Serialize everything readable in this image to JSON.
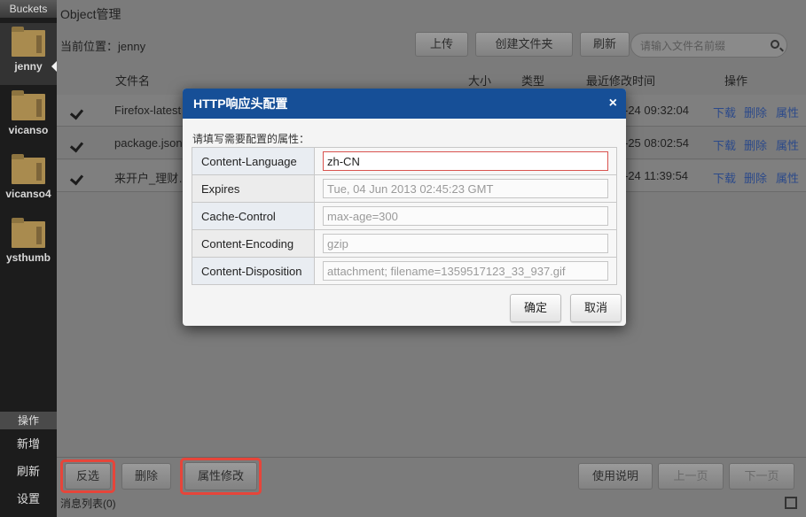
{
  "sidebar": {
    "header": "Buckets",
    "buckets": [
      {
        "label": "jenny"
      },
      {
        "label": "vicanso"
      },
      {
        "label": "vicanso4"
      },
      {
        "label": "ysthumb"
      }
    ],
    "ops_header": "操作",
    "ops": [
      {
        "label": "新增"
      },
      {
        "label": "刷新"
      },
      {
        "label": "设置"
      }
    ]
  },
  "main": {
    "title": "Object管理",
    "location": "当前位置：jenny",
    "toolbar": {
      "upload": "上传",
      "create_folder": "创建文件夹",
      "refresh": "刷新"
    },
    "search": {
      "placeholder": "请输入文件名前缀"
    },
    "columns": {
      "name": "文件名",
      "size": "大小",
      "type": "类型",
      "modified": "最近修改时间",
      "actions": "操作"
    },
    "rows": [
      {
        "name": "Firefox-latest",
        "modified": "-24 09:32:04",
        "download": "下载",
        "delete": "删除",
        "props": "属性"
      },
      {
        "name": "package.json",
        "modified": "-25 08:02:54",
        "download": "下载",
        "delete": "删除",
        "props": "属性"
      },
      {
        "name": "来开户_理财…",
        "modified": "-24 11:39:54",
        "download": "下载",
        "delete": "删除",
        "props": "属性"
      }
    ],
    "bottom": {
      "invert": "反选",
      "delete": "删除",
      "edit_props": "属性修改",
      "help": "使用说明",
      "prev": "上一页",
      "next": "下一页"
    },
    "status": "消息列表(0)"
  },
  "dialog": {
    "title": "HTTP响应头配置",
    "close": "×",
    "prompt": "请填写需要配置的属性：",
    "fields": [
      {
        "key": "Content-Language",
        "value": "zh-CN",
        "placeholder": ""
      },
      {
        "key": "Expires",
        "value": "",
        "placeholder": "Tue, 04 Jun 2013 02:45:23 GMT"
      },
      {
        "key": "Cache-Control",
        "value": "",
        "placeholder": "max-age=300"
      },
      {
        "key": "Content-Encoding",
        "value": "",
        "placeholder": "gzip"
      },
      {
        "key": "Content-Disposition",
        "value": "",
        "placeholder": "attachment; filename=1359517123_33_937.gif"
      }
    ],
    "confirm": "确定",
    "cancel": "取消"
  },
  "colors": {
    "dialog_title_bg": "#164f97",
    "highlight": "#e6453a",
    "link": "#2c4a8a"
  }
}
